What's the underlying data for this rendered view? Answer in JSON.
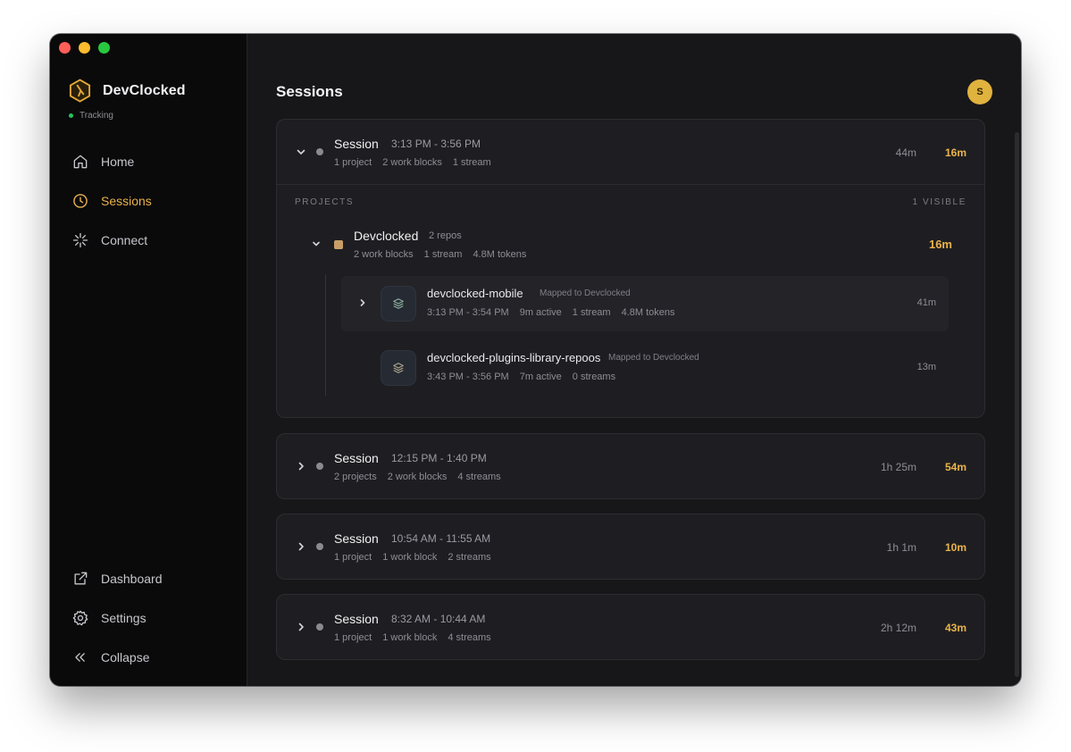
{
  "app": {
    "name": "DevClocked",
    "status": "Tracking"
  },
  "nav": {
    "top": [
      {
        "label": "Home",
        "icon": "home-icon"
      },
      {
        "label": "Sessions",
        "icon": "clock-icon",
        "active": true
      },
      {
        "label": "Connect",
        "icon": "connect-icon"
      }
    ],
    "bottom": [
      {
        "label": "Dashboard",
        "icon": "external-link-icon"
      },
      {
        "label": "Settings",
        "icon": "gear-icon"
      },
      {
        "label": "Collapse",
        "icon": "double-chevron-left-icon"
      }
    ]
  },
  "header": {
    "title": "Sessions",
    "avatar_initial": "S"
  },
  "sessions": [
    {
      "title": "Session",
      "time": "3:13 PM - 3:56 PM",
      "meta": [
        "1 project",
        "2 work blocks",
        "1 stream"
      ],
      "total": "44m",
      "active": "16m",
      "expanded": true,
      "projects_label": "PROJECTS",
      "visible_label": "1 VISIBLE",
      "project": {
        "name": "Devclocked",
        "repos": "2 repos",
        "meta": [
          "2 work blocks",
          "1 stream",
          "4.8M tokens"
        ],
        "time": "16m",
        "repos_list": [
          {
            "name": "devclocked-mobile",
            "mapped": "Mapped to Devclocked",
            "meta": [
              "3:13 PM - 3:54 PM",
              "9m active",
              "1 stream",
              "4.8M tokens"
            ],
            "time": "41m"
          },
          {
            "name": "devclocked-plugins-library-repoos",
            "mapped": "Mapped to Devclocked",
            "meta": [
              "3:43 PM - 3:56 PM",
              "7m active",
              "0 streams"
            ],
            "time": "13m"
          }
        ]
      }
    },
    {
      "title": "Session",
      "time": "12:15 PM - 1:40 PM",
      "meta": [
        "2 projects",
        "2 work blocks",
        "4 streams"
      ],
      "total": "1h 25m",
      "active": "54m"
    },
    {
      "title": "Session",
      "time": "10:54 AM - 11:55 AM",
      "meta": [
        "1 project",
        "1 work block",
        "2 streams"
      ],
      "total": "1h 1m",
      "active": "10m"
    },
    {
      "title": "Session",
      "time": "8:32 AM - 10:44 AM",
      "meta": [
        "1 project",
        "1 work block",
        "4 streams"
      ],
      "total": "2h 12m",
      "active": "43m"
    }
  ],
  "colors": {
    "accent": "#eab44b",
    "tracking": "#22c55e",
    "avatar": "#e0b23e",
    "project_swatch": "#c8a067"
  }
}
